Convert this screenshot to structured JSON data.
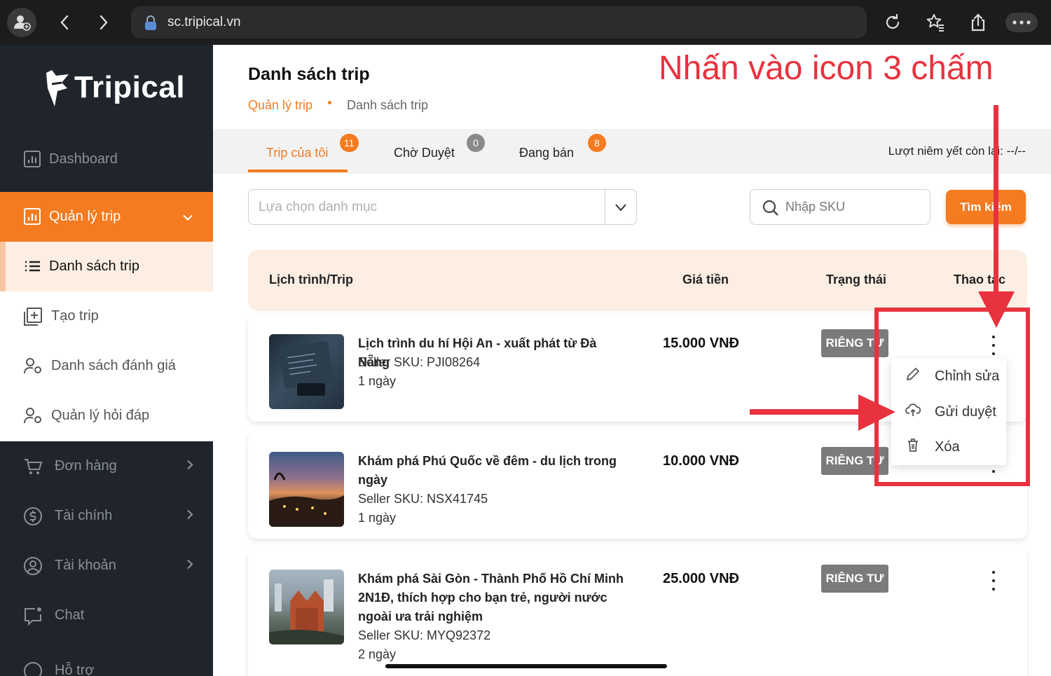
{
  "browser": {
    "url": "sc.tripical.vn",
    "icons": [
      "profile-icon",
      "back-icon",
      "forward-icon",
      "lock-icon",
      "reload-icon",
      "favorites-icon",
      "share-icon",
      "more-icon"
    ]
  },
  "sidebar": {
    "logo": "Tripical",
    "items": [
      {
        "label": "Dashboard",
        "icon": "dashboard-icon"
      },
      {
        "label": "Quản lý trip",
        "icon": "chart-icon"
      },
      {
        "label": "Danh sách trip",
        "icon": "list-icon"
      },
      {
        "label": "Tạo trip",
        "icon": "add-square-icon"
      },
      {
        "label": "Danh sách đánh giá",
        "icon": "users-gear-icon"
      },
      {
        "label": "Quản lý hỏi đáp",
        "icon": "users-gear-icon"
      },
      {
        "label": "Đơn hàng",
        "icon": "cart-icon"
      },
      {
        "label": "Tài chính",
        "icon": "dollar-icon"
      },
      {
        "label": "Tài khoản",
        "icon": "user-circle-icon"
      },
      {
        "label": "Chat",
        "icon": "chat-icon"
      },
      {
        "label": "Hỗ trợ",
        "icon": "help-icon"
      }
    ]
  },
  "header": {
    "title": "Danh sách trip",
    "breadcrumb": [
      "Quản lý trip",
      "Danh sách trip"
    ],
    "annotation": "Nhấn vào icon 3 chấm"
  },
  "tabs": [
    {
      "label": "Trip của tôi",
      "count": "11"
    },
    {
      "label": "Chờ Duyệt",
      "count": "0"
    },
    {
      "label": "Đang bán",
      "count": "8"
    }
  ],
  "quota": "Lượt niêm yết còn lại: --/--",
  "filters": {
    "category_placeholder": "Lựa chọn danh mục",
    "sku_placeholder": "Nhập SKU",
    "search_label": "Tìm kiếm"
  },
  "table": {
    "headers": [
      "Lịch trình/Trip",
      "Giá tiền",
      "Trạng thái",
      "Thao tác"
    ],
    "rows": [
      {
        "name": "Lịch trình du hí Hội An - xuất phát từ Đà Nẵng",
        "sku": "Seller SKU: PJI08264",
        "duration": "1 ngày",
        "price": "15.000 VNĐ",
        "status": "RIÊNG TƯ"
      },
      {
        "name": "Khám phá Phú Quốc về đêm - du lịch trong ngày",
        "sku": "Seller SKU: NSX41745",
        "duration": "1 ngày",
        "price": "10.000 VNĐ",
        "status": "RIÊNG TƯ"
      },
      {
        "name": "Khám phá Sài Gòn - Thành Phố Hồ Chí Minh 2N1Đ, thích hợp cho bạn trẻ, người nước ngoài ưa trải nghiệm",
        "sku": "Seller SKU: MYQ92372",
        "duration": "2 ngày",
        "price": "25.000 VNĐ",
        "status": "RIÊNG TƯ"
      }
    ]
  },
  "context_menu": {
    "items": [
      {
        "label": "Chỉnh sửa",
        "icon": "pencil-icon"
      },
      {
        "label": "Gửi duyệt",
        "icon": "upload-cloud-icon"
      },
      {
        "label": "Xóa",
        "icon": "trash-icon"
      }
    ]
  },
  "colors": {
    "accent": "#f47b20",
    "annotation": "#e8323e",
    "sidebar": "#1f252b",
    "status": "#7b7b7b"
  }
}
